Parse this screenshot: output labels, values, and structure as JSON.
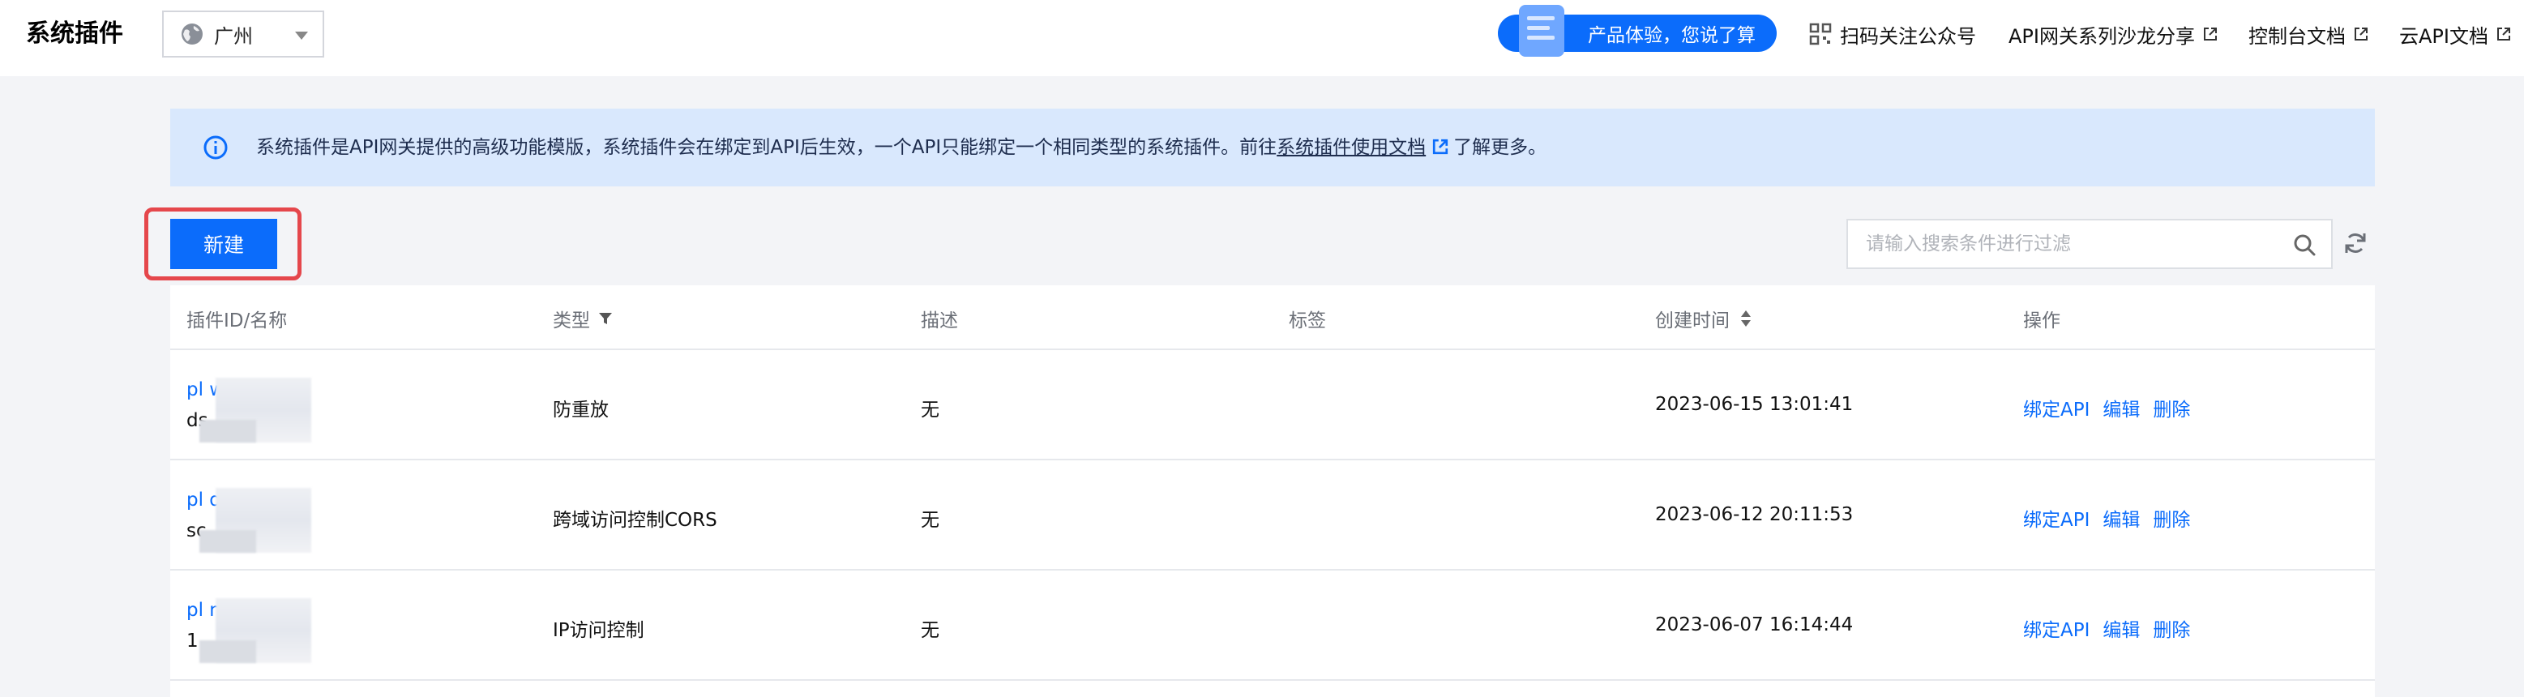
{
  "header": {
    "title": "系统插件",
    "region": "广州",
    "feedback": "产品体验，您说了算",
    "links": [
      {
        "label": "扫码关注公众号"
      },
      {
        "label": "API网关系列沙龙分享"
      },
      {
        "label": "控制台文档"
      },
      {
        "label": "云API文档"
      }
    ]
  },
  "banner": {
    "text_before": "系统插件是API网关提供的高级功能模版，系统插件会在绑定到API后生效，一个API只能绑定一个相同类型的系统插件。前往",
    "link_text": "系统插件使用文档",
    "text_after": "了解更多。"
  },
  "toolbar": {
    "create_label": "新建",
    "search_placeholder": "请输入搜索条件进行过滤"
  },
  "table": {
    "columns": [
      "插件ID/名称",
      "类型",
      "描述",
      "标签",
      "创建时间",
      "操作"
    ],
    "rows": [
      {
        "id": "pl        wl",
        "name": "ds",
        "type": "防重放",
        "description": "无",
        "tags": "",
        "created": "2023-06-15 13:01:41"
      },
      {
        "id": "pl        q9t",
        "name": "sc",
        "type": "跨域访问控制CORS",
        "description": "无",
        "tags": "",
        "created": "2023-06-12 20:11:53"
      },
      {
        "id": "pl        nsf",
        "name": "1",
        "type": "IP访问控制",
        "description": "无",
        "tags": "",
        "created": "2023-06-07 16:14:44"
      }
    ],
    "actions": [
      "绑定API",
      "编辑",
      "删除"
    ]
  },
  "colors": {
    "primary": "#0b6cfb",
    "banner_bg": "#d9e8fd",
    "highlight": "#e5474c",
    "page_bg": "#f3f4f7"
  },
  "icons": [
    "globe-icon",
    "chevron-down-icon",
    "qr-code-icon",
    "external-link-icon",
    "info-icon",
    "search-icon",
    "refresh-icon",
    "filter-icon",
    "sort-icon"
  ]
}
